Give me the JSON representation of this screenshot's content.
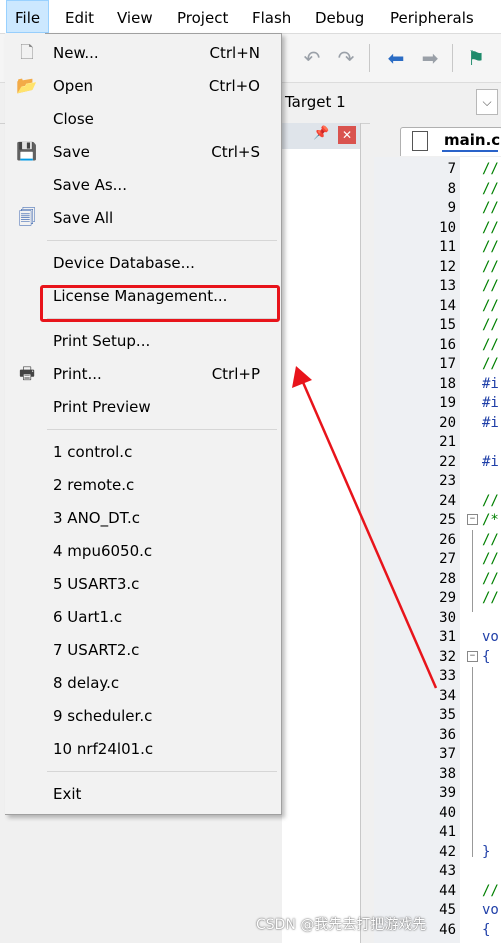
{
  "menubar": {
    "items": [
      "File",
      "Edit",
      "View",
      "Project",
      "Flash",
      "Debug",
      "Peripherals"
    ]
  },
  "target": {
    "label": "Target 1"
  },
  "editor": {
    "tab_label": "main.c",
    "lines": [
      {
        "n": "7",
        "c": "//"
      },
      {
        "n": "8",
        "c": "//"
      },
      {
        "n": "9",
        "c": "//"
      },
      {
        "n": "10",
        "c": "//"
      },
      {
        "n": "11",
        "c": "//"
      },
      {
        "n": "12",
        "c": "//"
      },
      {
        "n": "13",
        "c": "//"
      },
      {
        "n": "14",
        "c": "//"
      },
      {
        "n": "15",
        "c": "//"
      },
      {
        "n": "16",
        "c": "//"
      },
      {
        "n": "17",
        "c": "//"
      },
      {
        "n": "18",
        "c": "#i"
      },
      {
        "n": "19",
        "c": "#i"
      },
      {
        "n": "20",
        "c": "#i"
      },
      {
        "n": "21",
        "c": ""
      },
      {
        "n": "22",
        "c": "#i"
      },
      {
        "n": "23",
        "c": ""
      },
      {
        "n": "24",
        "c": "//"
      },
      {
        "n": "25",
        "c": "/*"
      },
      {
        "n": "26",
        "c": "//"
      },
      {
        "n": "27",
        "c": "//"
      },
      {
        "n": "28",
        "c": "//"
      },
      {
        "n": "29",
        "c": "//"
      },
      {
        "n": "30",
        "c": ""
      },
      {
        "n": "31",
        "c": "vo"
      },
      {
        "n": "32",
        "c": "{"
      },
      {
        "n": "33",
        "c": ""
      },
      {
        "n": "34",
        "c": ""
      },
      {
        "n": "35",
        "c": ""
      },
      {
        "n": "36",
        "c": ""
      },
      {
        "n": "37",
        "c": ""
      },
      {
        "n": "38",
        "c": ""
      },
      {
        "n": "39",
        "c": ""
      },
      {
        "n": "40",
        "c": ""
      },
      {
        "n": "41",
        "c": ""
      },
      {
        "n": "42",
        "c": "}"
      },
      {
        "n": "43",
        "c": ""
      },
      {
        "n": "44",
        "c": "//"
      },
      {
        "n": "45",
        "c": "vo"
      },
      {
        "n": "46",
        "c": "{"
      }
    ]
  },
  "file_menu": {
    "new": {
      "label": "New...",
      "shortcut": "Ctrl+N"
    },
    "open": {
      "label": "Open",
      "shortcut": "Ctrl+O"
    },
    "close": {
      "label": "Close"
    },
    "save": {
      "label": "Save",
      "shortcut": "Ctrl+S"
    },
    "save_as": {
      "label": "Save As..."
    },
    "save_all": {
      "label": "Save All"
    },
    "device_db": {
      "label": "Device Database..."
    },
    "license": {
      "label": "License Management..."
    },
    "print_setup": {
      "label": "Print Setup..."
    },
    "print": {
      "label": "Print...",
      "shortcut": "Ctrl+P"
    },
    "print_preview": {
      "label": "Print Preview"
    },
    "recent": [
      "1 control.c",
      "2 remote.c",
      "3 ANO_DT.c",
      "4 mpu6050.c",
      "5 USART3.c",
      "6 Uart1.c",
      "7 USART2.c",
      "8 delay.c",
      "9 scheduler.c",
      "10 nrf24l01.c"
    ],
    "exit": {
      "label": "Exit"
    }
  },
  "watermark": "CSDN @我先去打把游戏先",
  "colors": {
    "highlight": "#e8141b",
    "arrow": "#e8141b",
    "menu_active": "#cce8ff",
    "tab_accent": "#2a63c9"
  }
}
